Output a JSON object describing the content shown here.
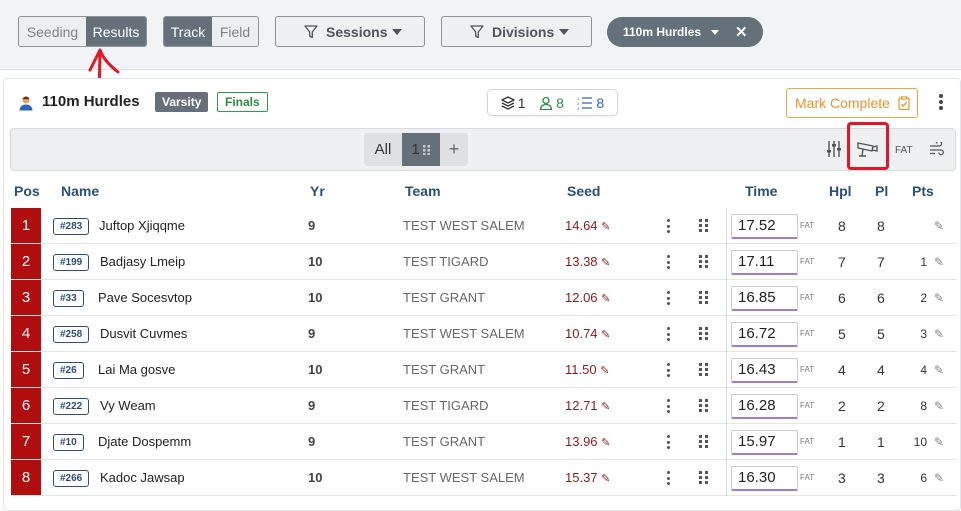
{
  "topbar": {
    "view_toggle": {
      "options": [
        "Seeding",
        "Results"
      ],
      "active": "Results"
    },
    "type_toggle": {
      "options": [
        "Track",
        "Field"
      ],
      "active": "Track"
    },
    "sessions_label": "Sessions",
    "divisions_label": "Divisions",
    "event_pill": "110m Hurdles"
  },
  "event": {
    "title": "110m Hurdles",
    "level_badge": "Varsity",
    "round_badge": "Finals",
    "counts": {
      "heats": "1",
      "entries": "8",
      "results": "8"
    },
    "mark_complete_label": "Mark Complete"
  },
  "heat_toolbar": {
    "all_label": "All",
    "current_heat": "1",
    "add_label": "+",
    "fat_label": "FAT"
  },
  "columns": {
    "pos": "Pos",
    "name": "Name",
    "yr": "Yr",
    "team": "Team",
    "seed": "Seed",
    "time": "Time",
    "hpl": "Hpl",
    "pl": "Pl",
    "pts": "Pts"
  },
  "rows": [
    {
      "pos": "1",
      "bib": "#283",
      "name": "Juftop Xjiqqme",
      "yr": "9",
      "team": "TEST WEST SALEM",
      "seed": "14.64",
      "time": "17.52",
      "fat": "FAT",
      "hpl": "8",
      "pl": "8",
      "pts": ""
    },
    {
      "pos": "2",
      "bib": "#199",
      "name": "Badjasy Lmeip",
      "yr": "10",
      "team": "TEST TIGARD",
      "seed": "13.38",
      "time": "17.11",
      "fat": "FAT",
      "hpl": "7",
      "pl": "7",
      "pts": "1"
    },
    {
      "pos": "3",
      "bib": "#33",
      "name": "Pave Socesvtop",
      "yr": "10",
      "team": "TEST GRANT",
      "seed": "12.06",
      "time": "16.85",
      "fat": "FAT",
      "hpl": "6",
      "pl": "6",
      "pts": "2"
    },
    {
      "pos": "4",
      "bib": "#258",
      "name": "Dusvit Cuvmes",
      "yr": "9",
      "team": "TEST WEST SALEM",
      "seed": "10.74",
      "time": "16.72",
      "fat": "FAT",
      "hpl": "5",
      "pl": "5",
      "pts": "3"
    },
    {
      "pos": "5",
      "bib": "#26",
      "name": "Lai Ma gosve",
      "yr": "10",
      "team": "TEST GRANT",
      "seed": "11.50",
      "time": "16.43",
      "fat": "FAT",
      "hpl": "4",
      "pl": "4",
      "pts": "4"
    },
    {
      "pos": "6",
      "bib": "#222",
      "name": "Vy Weam",
      "yr": "9",
      "team": "TEST TIGARD",
      "seed": "12.71",
      "time": "16.28",
      "fat": "FAT",
      "hpl": "2",
      "pl": "2",
      "pts": "8"
    },
    {
      "pos": "7",
      "bib": "#10",
      "name": "Djate Dospemm",
      "yr": "9",
      "team": "TEST GRANT",
      "seed": "13.96",
      "time": "15.97",
      "fat": "FAT",
      "hpl": "1",
      "pl": "1",
      "pts": "10"
    },
    {
      "pos": "8",
      "bib": "#266",
      "name": "Kadoc Jawsap",
      "yr": "10",
      "team": "TEST WEST SALEM",
      "seed": "15.37",
      "time": "16.30",
      "fat": "FAT",
      "hpl": "3",
      "pl": "3",
      "pts": "6"
    }
  ],
  "colors": {
    "position_red": "#b00e0e",
    "accent_gray": "#66707a",
    "finals_green": "#2e8a44",
    "mark_complete_orange": "#e8932a",
    "bib_blue": "#2b4f7a",
    "annotation_red": "#e0182a"
  }
}
